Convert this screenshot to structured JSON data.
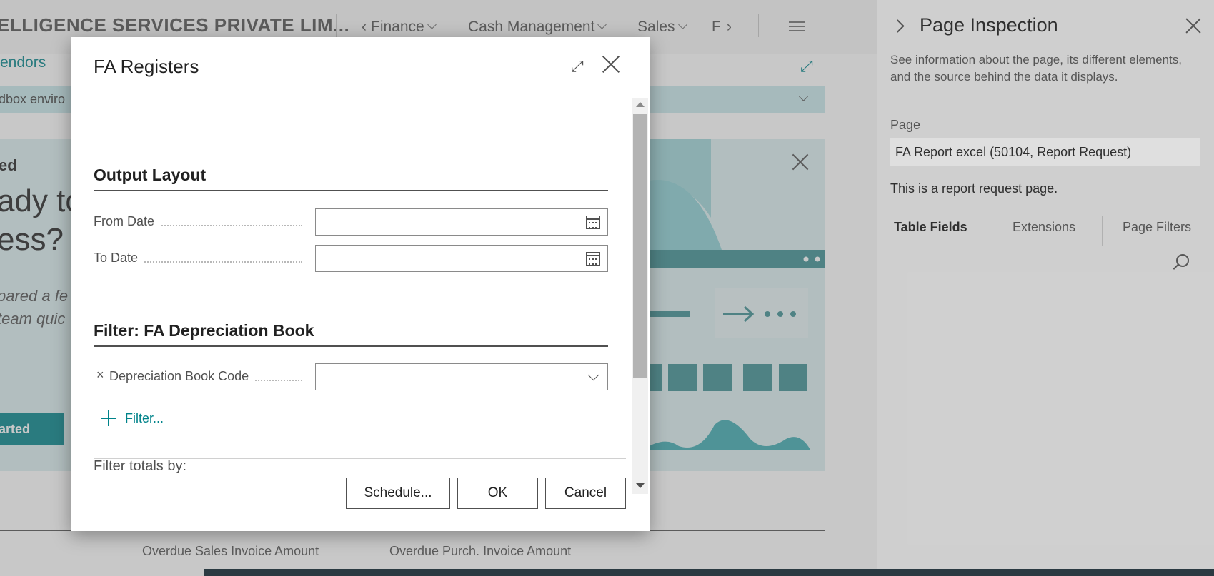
{
  "app": {
    "company_name": "ELLIGENCE SERVICES PRIVATE LIM...",
    "nav": [
      "Finance",
      "Cash Management",
      "Sales",
      "F"
    ],
    "subnav_link": "endors",
    "sandbox_text": "dbox enviro",
    "hero": {
      "title_fragment": "ed",
      "heading_lines": [
        "ady to",
        "ess?"
      ],
      "body_lines": [
        "pared a fe",
        "team quic"
      ],
      "button_label": "arted"
    },
    "cues": [
      "Overdue Sales Invoice Amount",
      "Overdue Purch. Invoice Amount"
    ]
  },
  "dialog": {
    "title": "FA Registers",
    "section_output": "Output Layout",
    "fields": {
      "from_date": {
        "label": "From Date",
        "value": ""
      },
      "to_date": {
        "label": "To Date",
        "value": ""
      }
    },
    "section_filter": "Filter: FA Depreciation Book",
    "filter_field": {
      "label": "Depreciation Book Code",
      "remove_glyph": "×",
      "value": ""
    },
    "add_filter_label": "Filter...",
    "filter_totals_label": "Filter totals by:",
    "buttons": {
      "schedule": "Schedule...",
      "ok": "OK",
      "cancel": "Cancel"
    }
  },
  "inspection_panel": {
    "title": "Page Inspection",
    "description": "See information about the page, its different elements, and the source behind the data it displays.",
    "page_label": "Page",
    "page_value": "FA Report excel (50104, Report Request)",
    "page_note": "This is a report request page.",
    "tabs": [
      "Table Fields",
      "Extensions",
      "Page Filters"
    ],
    "active_tab": "Table Fields"
  },
  "colors": {
    "accent": "#00838a",
    "hero_bg": "#dceff1",
    "sandbox_bar": "#c9e9ec"
  }
}
